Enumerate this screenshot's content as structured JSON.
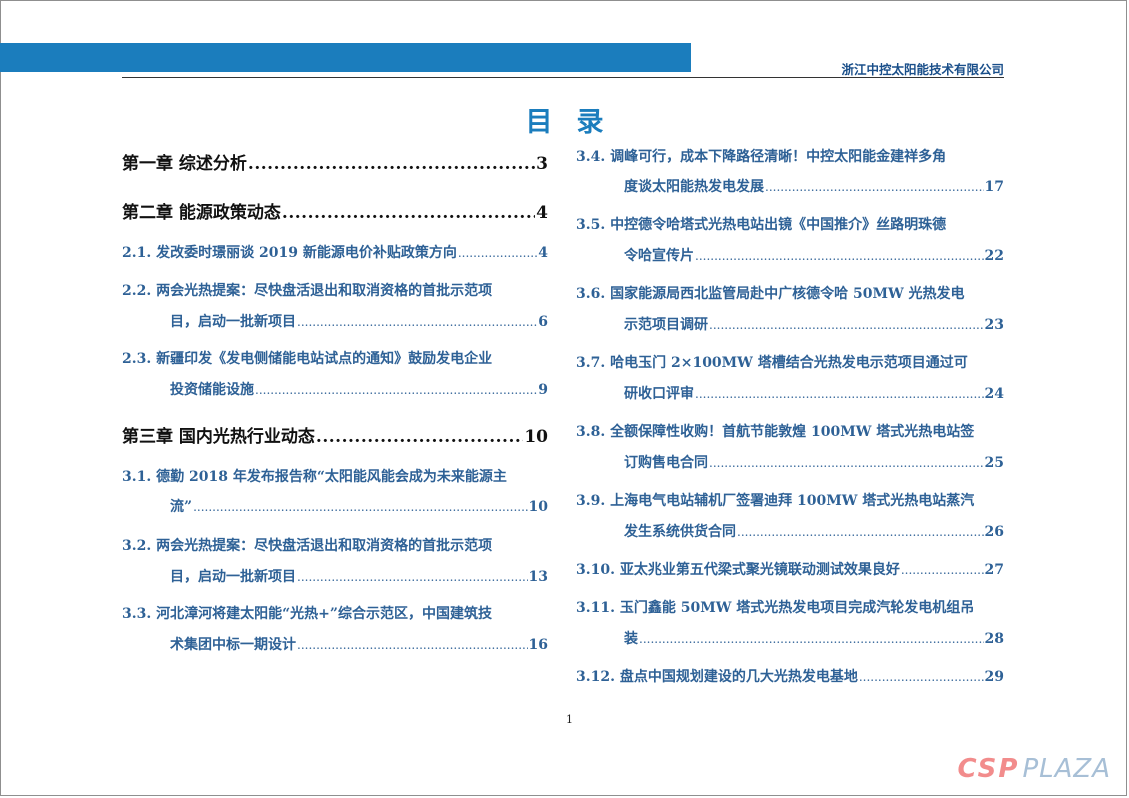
{
  "header": {
    "company": "浙江中控太阳能技术有限公司"
  },
  "toc_title": "目录",
  "left": {
    "ch1": {
      "title": "第一章  综述分析",
      "page": "3"
    },
    "ch2": {
      "title": "第二章  能源政策动态",
      "page": "4"
    },
    "e2_1": {
      "line": "2.1.  发改委时璟丽谈 2019 新能源电价补贴政策方向",
      "page": "4"
    },
    "e2_2": {
      "line1": "2.2.  两会光热提案：尽快盘活退出和取消资格的首批示范项",
      "line2": "目，启动一批新项目",
      "page": "6"
    },
    "e2_3": {
      "line1": "2.3.  新疆印发《发电侧储能电站试点的通知》鼓励发电企业",
      "line2": "投资储能设施",
      "page": "9"
    },
    "ch3": {
      "title": "第三章  国内光热行业动态",
      "page": "10"
    },
    "e3_1": {
      "line1": "3.1.  德勤 2018 年发布报告称“太阳能风能会成为未来能源主",
      "line2": "流”",
      "page": "10"
    },
    "e3_2": {
      "line1": "3.2.  两会光热提案：尽快盘活退出和取消资格的首批示范项",
      "line2": "目，启动一批新项目",
      "page": "13"
    },
    "e3_3": {
      "line1": "3.3.  河北漳河将建太阳能“光热+”综合示范区，中国建筑技",
      "line2": "术集团中标一期设计",
      "page": "16"
    }
  },
  "right": {
    "e3_4": {
      "line1": "3.4.  调峰可行，成本下降路径清晰！中控太阳能金建祥多角",
      "line2": "度谈太阳能热发电发展",
      "page": "17"
    },
    "e3_5": {
      "line1": "3.5.  中控德令哈塔式光热电站出镜《中国推介》丝路明珠德",
      "line2": "令哈宣传片",
      "page": "22"
    },
    "e3_6": {
      "line1": "3.6.  国家能源局西北监管局赴中广核德令哈 50MW 光热发电",
      "line2": "示范项目调研",
      "page": "23"
    },
    "e3_7": {
      "line1": "3.7.  哈电玉门 2×100MW 塔槽结合光热发电示范项目通过可",
      "line2": "研收口评审",
      "page": "24"
    },
    "e3_8": {
      "line1": "3.8.  全额保障性收购！首航节能敦煌 100MW 塔式光热电站签",
      "line2": "订购售电合同",
      "page": "25"
    },
    "e3_9": {
      "line1": "3.9.  上海电气电站辅机厂签署迪拜 100MW 塔式光热电站蒸汽",
      "line2": "发生系统供货合同",
      "page": "26"
    },
    "e3_10": {
      "line": "3.10.  亚太兆业第五代梁式聚光镜联动测试效果良好",
      "page": "27"
    },
    "e3_11": {
      "line1": "3.11.  玉门鑫能 50MW 塔式光热发电项目完成汽轮发电机组吊",
      "line2": "装",
      "page": "28"
    },
    "e3_12": {
      "line": "3.12.  盘点中国规划建设的几大光热发电基地",
      "page": "29"
    }
  },
  "footer": {
    "page_number": "1"
  },
  "watermark": {
    "part1": "CSP",
    "part2": "PLAZA"
  },
  "colors": {
    "accent": "#1b7dbd",
    "entry_text": "#2e6196",
    "company": "#1a4f8a"
  }
}
